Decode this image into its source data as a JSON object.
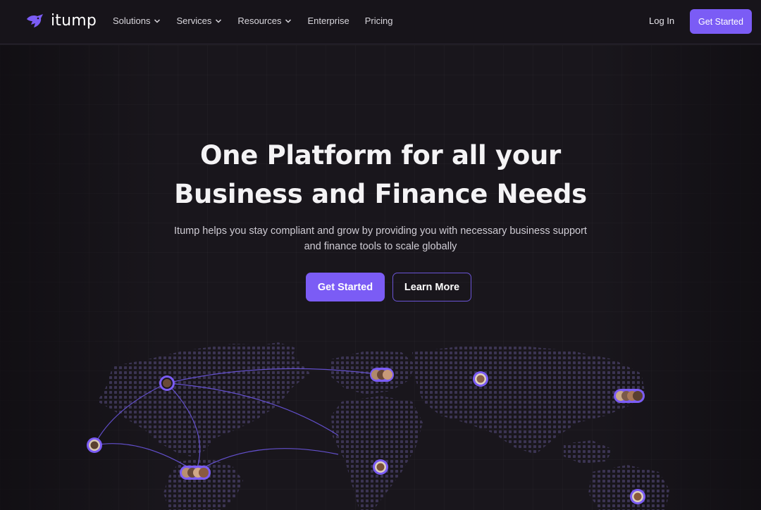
{
  "nav": {
    "logo_text": "itump",
    "links": [
      {
        "label": "Solutions",
        "has_dropdown": true
      },
      {
        "label": "Services",
        "has_dropdown": true
      },
      {
        "label": "Resources",
        "has_dropdown": true
      },
      {
        "label": "Enterprise",
        "has_dropdown": false
      },
      {
        "label": "Pricing",
        "has_dropdown": false
      }
    ],
    "login_label": "Log In",
    "cta_label": "Get Started"
  },
  "hero": {
    "title_line1": "One Platform for all your",
    "title_line2": "Business and Finance Needs",
    "subtitle_line1": "Itump helps you stay compliant and grow by providing you with necessary business support",
    "subtitle_line2": "and finance tools to scale globally",
    "primary_label": "Get Started",
    "secondary_label": "Learn More"
  },
  "colors": {
    "accent": "#7b5cf5",
    "background": "#19161c",
    "map_dot": "#3b3452",
    "connection_line": "#6b56e0"
  },
  "icons": {
    "logo": "bird-logo-icon",
    "dropdown": "chevron-down-icon",
    "map_marker": "avatar-pin-icon"
  }
}
